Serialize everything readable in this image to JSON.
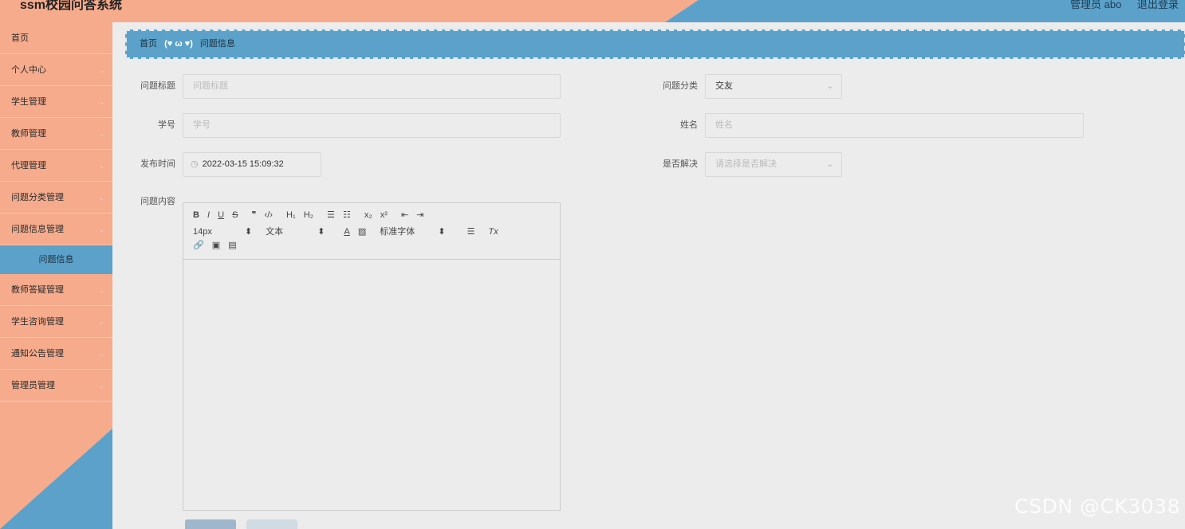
{
  "header": {
    "title": "ssm校园问答系统",
    "user": "管理员 abo",
    "logout": "退出登录"
  },
  "sidebar": {
    "items": [
      {
        "label": "首页"
      },
      {
        "label": "个人中心"
      },
      {
        "label": "学生管理"
      },
      {
        "label": "教师管理"
      },
      {
        "label": "代理管理"
      },
      {
        "label": "问题分类管理"
      },
      {
        "label": "问题信息管理"
      },
      {
        "label": "教师答疑管理"
      },
      {
        "label": "学生咨询管理"
      },
      {
        "label": "通知公告管理"
      },
      {
        "label": "管理员管理"
      }
    ],
    "sub_active": "问题信息",
    "chevron": "⌄"
  },
  "breadcrumb": {
    "home": "首页",
    "separator": "(♥ ω ♥)",
    "current": "问题信息"
  },
  "form": {
    "title_label": "问题标题",
    "title_placeholder": "问题标题",
    "category_label": "问题分类",
    "category_value": "交友",
    "student_no_label": "学号",
    "student_no_placeholder": "学号",
    "name_label": "姓名",
    "name_placeholder": "姓名",
    "time_label": "发布时间",
    "time_value": "2022-03-15 15:09:32",
    "resolved_label": "是否解决",
    "resolved_placeholder": "请选择是否解决",
    "content_label": "问题内容"
  },
  "editor": {
    "row1": [
      "B",
      "I",
      "U",
      "S",
      "❞",
      "‹/›",
      "H₁",
      "H₂",
      "☰",
      "☷",
      "x₂",
      "x²",
      "⇤",
      "⇥"
    ],
    "font_size": "14px",
    "text_type": "文本",
    "font_family": "标准字体",
    "row3": [
      "🔗",
      "▣",
      "▤"
    ],
    "select_arrow": "⬍",
    "color_a": "A",
    "bg_color": "▨",
    "align": "☰",
    "clear": "Tx"
  },
  "watermark": "CSDN @CK3038"
}
